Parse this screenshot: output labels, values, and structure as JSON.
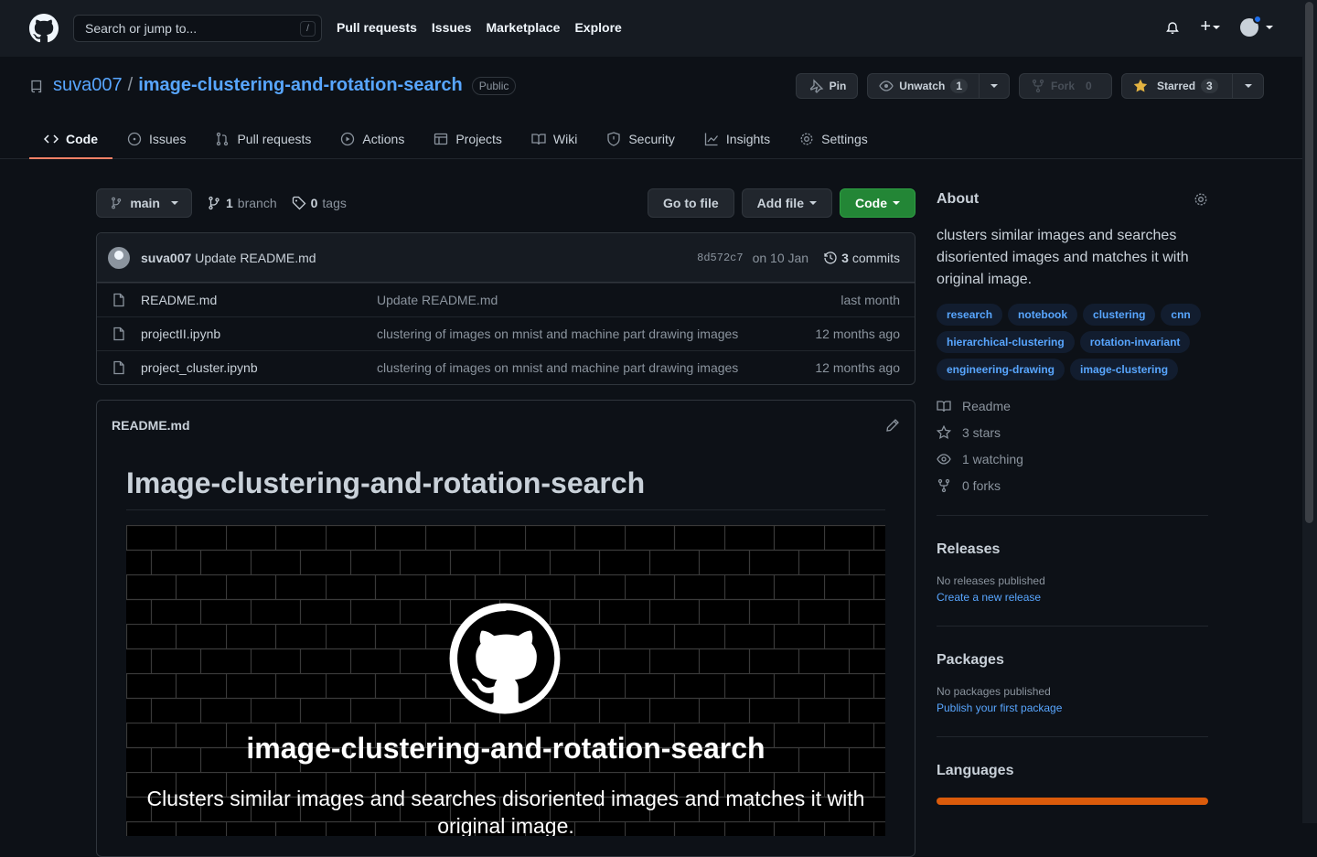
{
  "topnav": {
    "search_placeholder": "Search or jump to...",
    "search_shortcut": "/",
    "links": [
      "Pull requests",
      "Issues",
      "Marketplace",
      "Explore"
    ],
    "plus_label": "+"
  },
  "repo": {
    "owner": "suva007",
    "separator": "/",
    "name": "image-clustering-and-rotation-search",
    "visibility": "Public",
    "pin_label": "Pin",
    "unwatch_label": "Unwatch",
    "watch_count": "1",
    "fork_label": "Fork",
    "fork_count": "0",
    "starred_label": "Starred",
    "star_count": "3"
  },
  "tabs": [
    {
      "label": "Code",
      "icon": "code-icon"
    },
    {
      "label": "Issues",
      "icon": "issue-icon"
    },
    {
      "label": "Pull requests",
      "icon": "pull-request-icon"
    },
    {
      "label": "Actions",
      "icon": "play-icon"
    },
    {
      "label": "Projects",
      "icon": "table-icon"
    },
    {
      "label": "Wiki",
      "icon": "book-icon"
    },
    {
      "label": "Security",
      "icon": "shield-icon"
    },
    {
      "label": "Insights",
      "icon": "graph-icon"
    },
    {
      "label": "Settings",
      "icon": "gear-icon"
    }
  ],
  "branchbar": {
    "branch": "main",
    "branch_count": "1",
    "branch_word": "branch",
    "tag_count": "0",
    "tag_word": "tags",
    "goto_file": "Go to file",
    "add_file": "Add file",
    "code": "Code"
  },
  "commit": {
    "author": "suva007",
    "message": "Update README.md",
    "sha": "8d572c7",
    "date": "on 10 Jan",
    "count": "3",
    "count_word": "commits"
  },
  "files": [
    {
      "name": "README.md",
      "message": "Update README.md",
      "age": "last month"
    },
    {
      "name": "projectII.ipynb",
      "message": "clustering of images on mnist and machine part drawing images",
      "age": "12 months ago"
    },
    {
      "name": "project_cluster.ipynb",
      "message": "clustering of images on mnist and machine part drawing images",
      "age": "12 months ago"
    }
  ],
  "readme": {
    "filename": "README.md",
    "heading": "Image-clustering-and-rotation-search",
    "banner_title": "image-clustering-and-rotation-search",
    "banner_subtitle": "Clusters similar images and searches disoriented images and matches it with original image."
  },
  "about": {
    "heading": "About",
    "description": "clusters similar images and searches disoriented images and matches it with original image.",
    "topics": [
      "research",
      "notebook",
      "clustering",
      "cnn",
      "hierarchical-clustering",
      "rotation-invariant",
      "engineering-drawing",
      "image-clustering"
    ],
    "readme": "Readme",
    "stars": "3 stars",
    "watching": "1 watching",
    "forks": "0 forks"
  },
  "releases": {
    "heading": "Releases",
    "none": "No releases published",
    "link": "Create a new release"
  },
  "packages": {
    "heading": "Packages",
    "none": "No packages published",
    "link": "Publish your first package"
  },
  "languages": {
    "heading": "Languages",
    "bar_color": "#DA5B0B"
  },
  "colors": {
    "accent_link": "#58a6ff",
    "primary_button": "#238636",
    "active_tab_underline": "#f78166",
    "star_icon": "#e3b341"
  }
}
